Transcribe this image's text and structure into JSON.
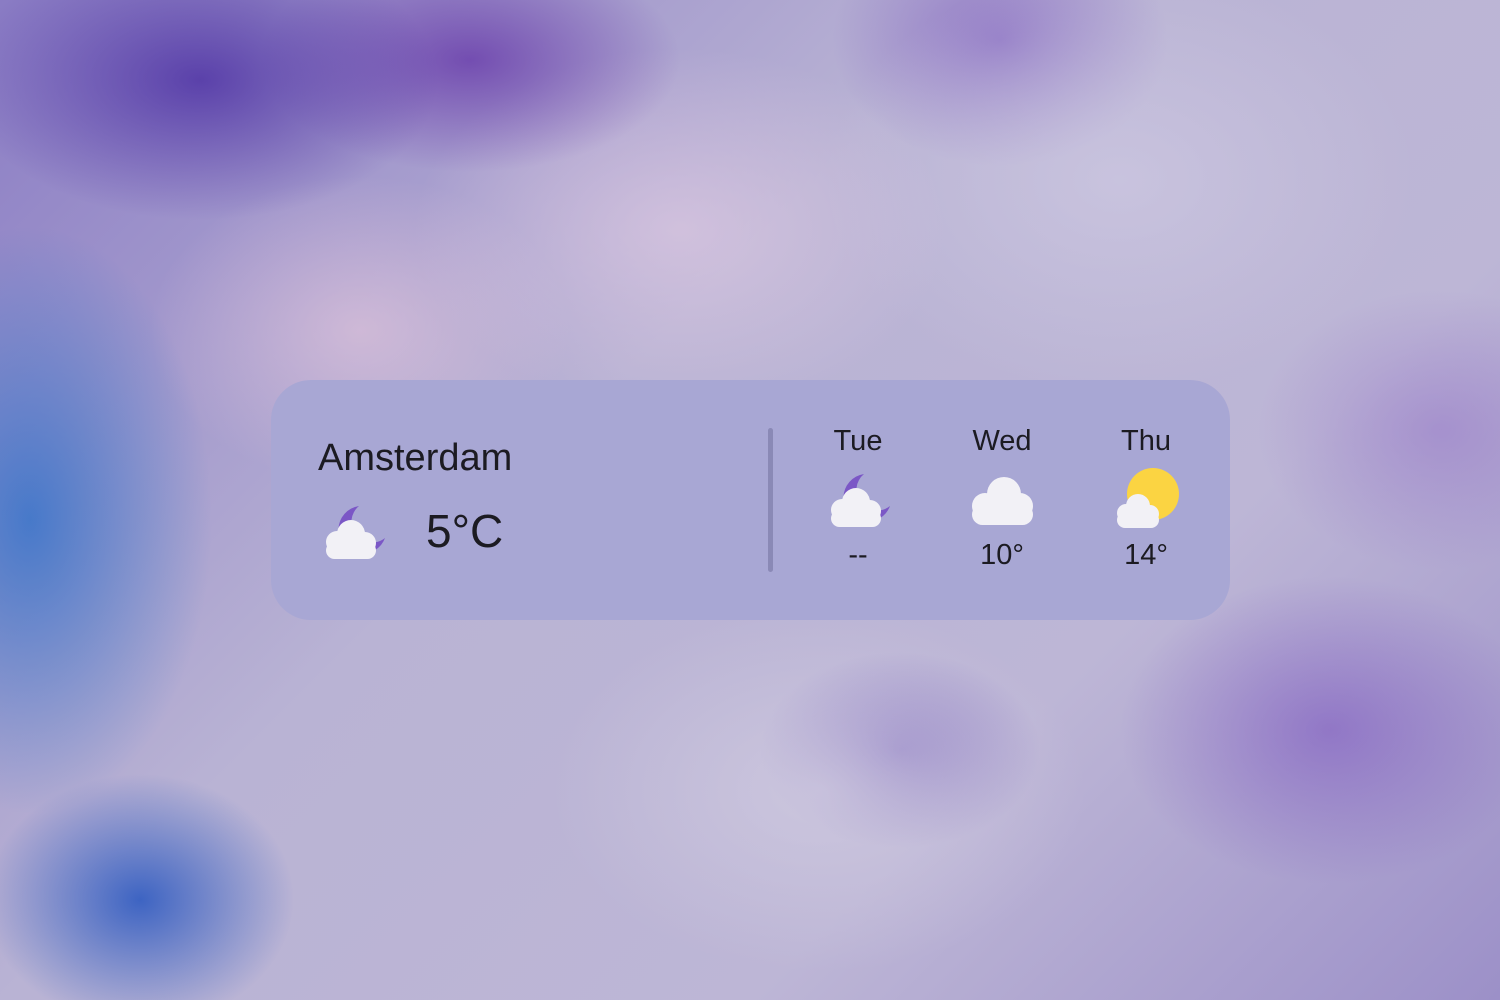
{
  "widget": {
    "city": "Amsterdam",
    "current": {
      "temperature": "5°C",
      "icon": "night-partly-cloudy-icon"
    },
    "forecast": [
      {
        "day": "Tue",
        "temp": "--",
        "icon": "night-partly-cloudy-icon"
      },
      {
        "day": "Wed",
        "temp": "10°",
        "icon": "cloud-icon"
      },
      {
        "day": "Thu",
        "temp": "14°",
        "icon": "sun-partly-cloudy-icon"
      }
    ]
  },
  "colors": {
    "widget_background": "#a8a7d4",
    "moon": "#7b57c6",
    "cloud": "#f2f1f6",
    "sun": "#fbd442",
    "text": "#1c1b22"
  }
}
